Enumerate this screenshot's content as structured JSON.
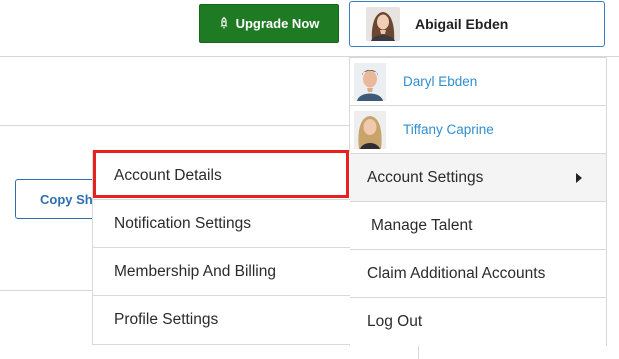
{
  "header": {
    "upgrade_label": "Upgrade Now",
    "upgrade_icon": "rocket-icon",
    "user_name": "Abigail Ebden"
  },
  "background": {
    "copy_button_label": "Copy Sh"
  },
  "account_menu": {
    "people": [
      {
        "name": "Daryl Ebden"
      },
      {
        "name": "Tiffany Caprine"
      }
    ],
    "account_settings_label": "Account Settings",
    "items": [
      {
        "label": "Manage Talent"
      },
      {
        "label": "Claim Additional Accounts"
      },
      {
        "label": "Log Out"
      }
    ]
  },
  "settings_submenu": {
    "items": [
      {
        "label": "Account Details"
      },
      {
        "label": "Notification Settings"
      },
      {
        "label": "Membership And Billing"
      },
      {
        "label": "Profile Settings"
      }
    ]
  },
  "colors": {
    "upgrade_green": "#1f7a24",
    "link_blue": "#2f8fd0",
    "highlight_red": "#e8201e"
  }
}
